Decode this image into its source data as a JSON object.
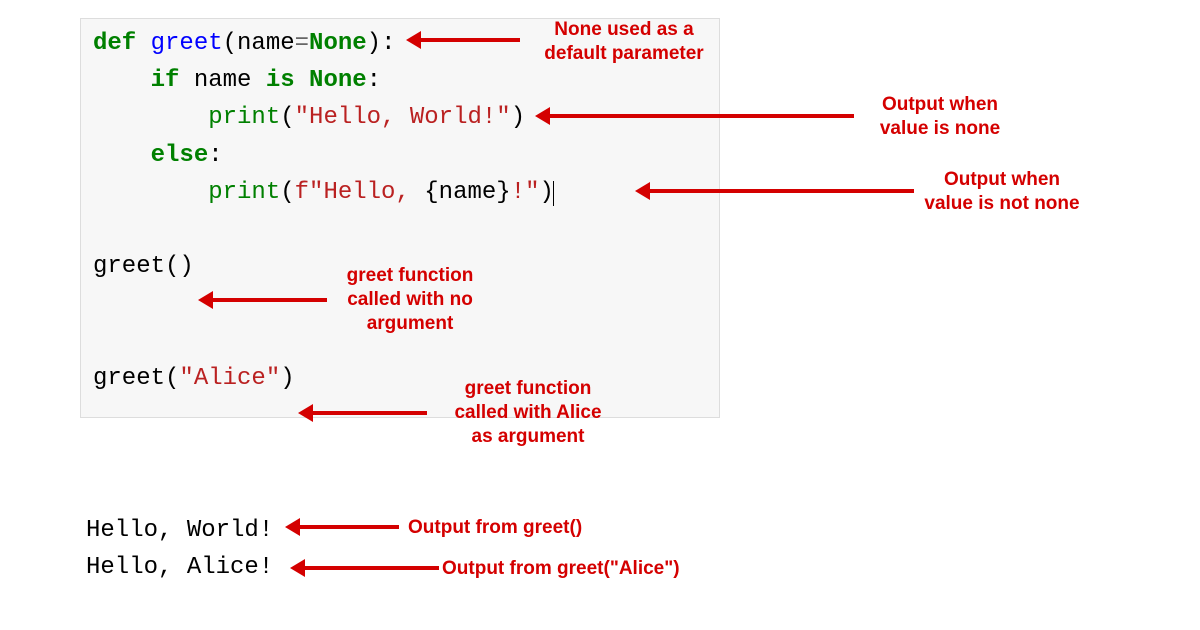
{
  "code": {
    "line1": {
      "def": "def ",
      "fn": "greet",
      "open": "(",
      "param": "name",
      "eq": "=",
      "none": "None",
      "close": ")",
      ":": ":"
    },
    "line2": {
      "indent": "    ",
      "if": "if ",
      "name": "name",
      "is": " is ",
      "none": "None",
      ":": ":"
    },
    "line3": {
      "indent": "        ",
      "print": "print",
      "open": "(",
      "str": "\"Hello, World!\"",
      "close": ")"
    },
    "line4": {
      "indent": "    ",
      "else": "else",
      ":": ":"
    },
    "line5": {
      "indent": "        ",
      "print": "print",
      "open": "(",
      "f": "f",
      "strOpen": "\"Hello, ",
      "lb": "{",
      "name": "name",
      "rb": "}",
      "bang": "!",
      "strClose": "\"",
      "close": ")"
    },
    "blank": "",
    "line6": {
      "call": "greet",
      "open": "(",
      "close": ")"
    },
    "line7": {
      "call": "greet",
      "open": "(",
      "arg": "\"Alice\"",
      "close": ")"
    }
  },
  "output": {
    "line1": "Hello, World!",
    "line2": "Hello, Alice!"
  },
  "annotations": {
    "a1_l1": "None used as a",
    "a1_l2": "default parameter",
    "a2_l1": "Output when",
    "a2_l2": "value is none",
    "a3_l1": "Output when",
    "a3_l2": "value is not none",
    "a4_l1": "greet function",
    "a4_l2": "called with no",
    "a4_l3": "argument",
    "a5_l1": "greet function",
    "a5_l2": "called with Alice",
    "a5_l3": "as argument",
    "a6": "Output from greet()",
    "a7": "Output from greet(\"Alice\")"
  }
}
